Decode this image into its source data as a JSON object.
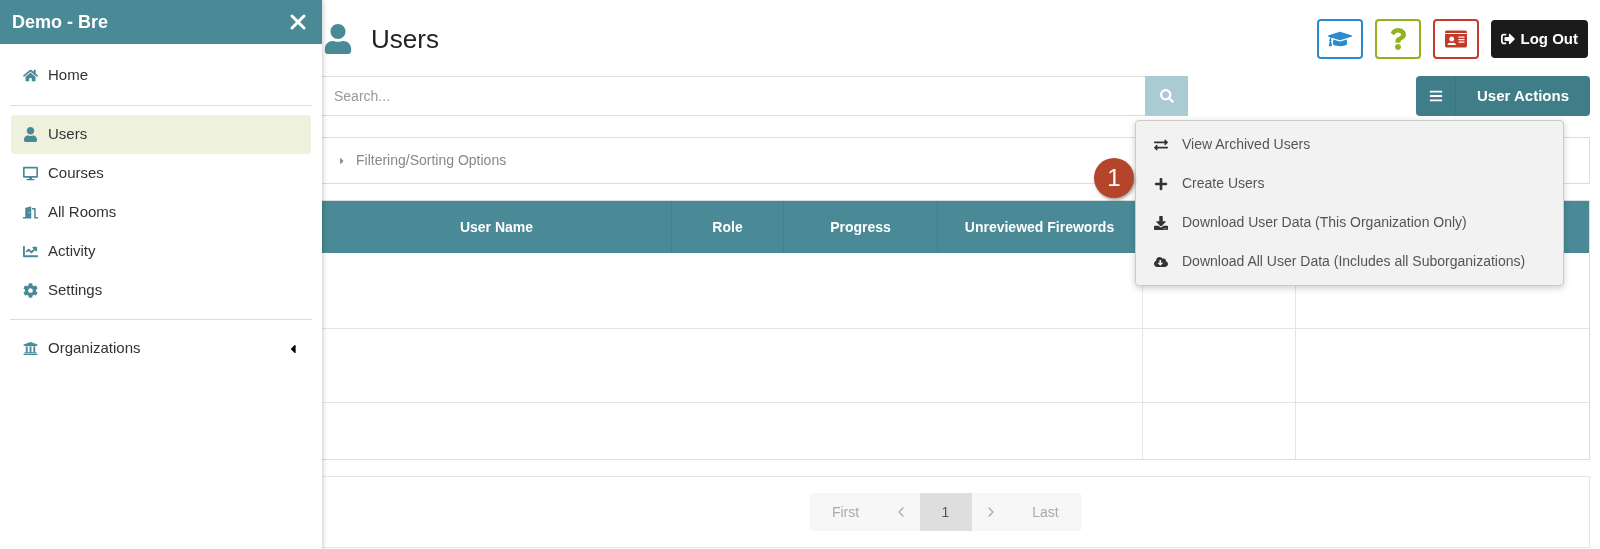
{
  "sidebar": {
    "title": "Demo - Bre",
    "items": [
      {
        "label": "Home",
        "selected": false
      },
      {
        "label": "Users",
        "selected": true
      },
      {
        "label": "Courses",
        "selected": false
      },
      {
        "label": "All Rooms",
        "selected": false
      },
      {
        "label": "Activity",
        "selected": false
      },
      {
        "label": "Settings",
        "selected": false
      },
      {
        "label": "Organizations",
        "selected": false,
        "expanded": false
      }
    ]
  },
  "page": {
    "title": "Users",
    "logout": "Log Out"
  },
  "search": {
    "placeholder": "Search..."
  },
  "user_actions": {
    "label": "User Actions",
    "expanded": true,
    "menu": [
      {
        "label": "View Archived Users"
      },
      {
        "label": "Create Users"
      },
      {
        "label": "Download User Data (This Organization Only)"
      },
      {
        "label": "Download All User Data (Includes all Suborganizations)"
      }
    ]
  },
  "callout": "1",
  "filter": {
    "label": "Filtering/Sorting Options",
    "expanded": false
  },
  "table": {
    "columns": [
      "User Name",
      "Role",
      "Progress",
      "Unreviewed Firewords"
    ]
  },
  "pagination": [
    {
      "label": "First",
      "kind": "text",
      "selected": false,
      "disabled": true
    },
    {
      "kind": "prev",
      "selected": false,
      "disabled": true
    },
    {
      "label": "1",
      "kind": "text",
      "selected": true,
      "disabled": false
    },
    {
      "kind": "next",
      "selected": false,
      "disabled": true
    },
    {
      "label": "Last",
      "kind": "text",
      "selected": false,
      "disabled": true
    }
  ]
}
